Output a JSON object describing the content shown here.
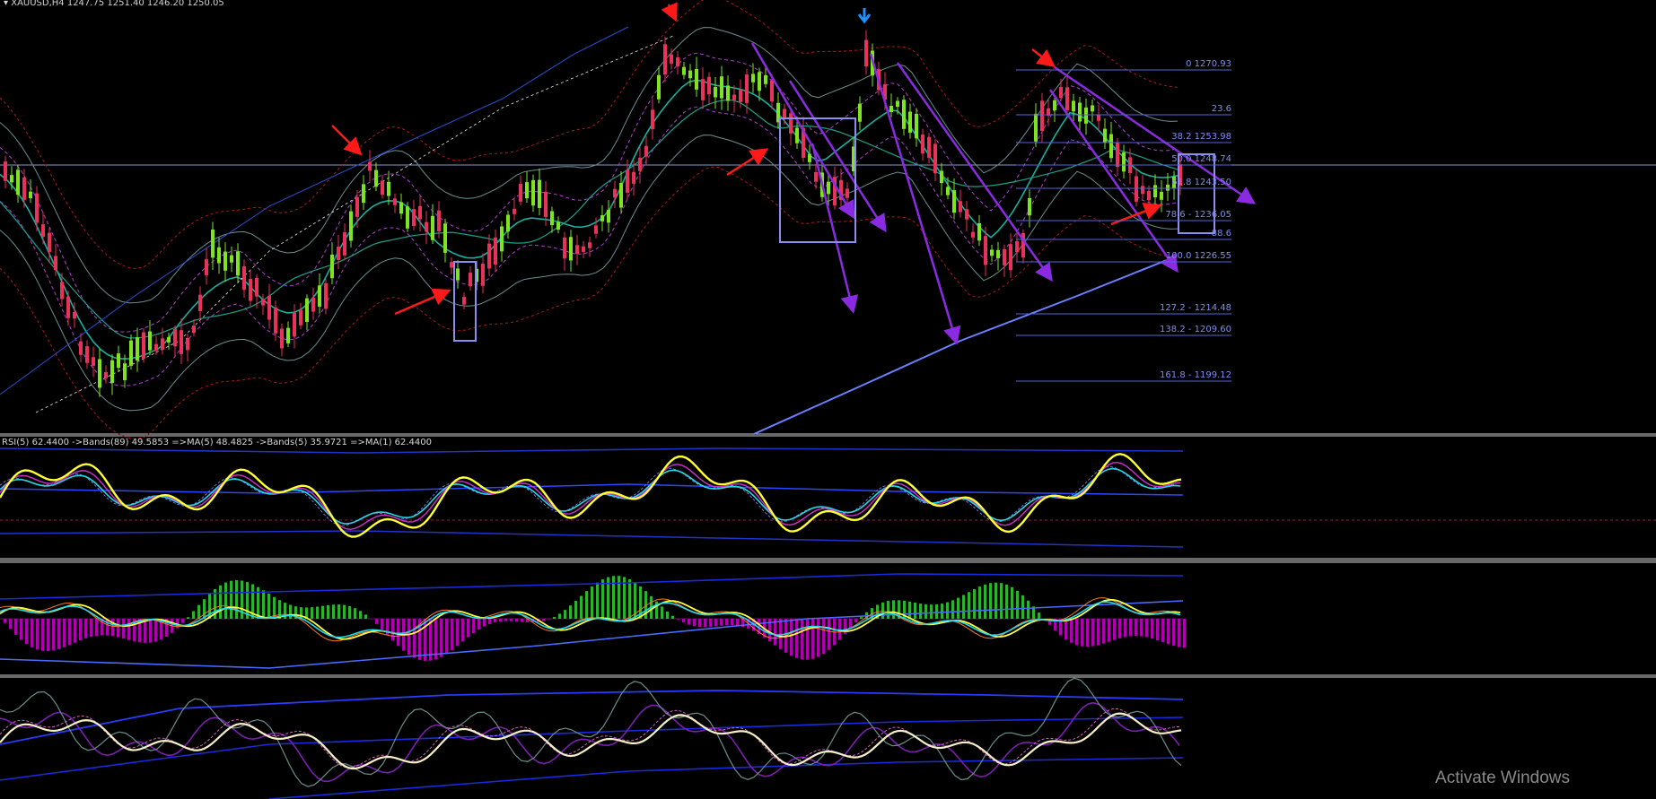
{
  "header": {
    "symbol_line": "XAUUSD,H4  1247.75 1251.40 1246.20 1250.05"
  },
  "rsi_panel": {
    "label": "RSI(5) 62.4400  ->Bands(89) 49.5853  =>MA(5) 48.4825  ->Bands(5) 35.9721  =>MA(1) 62.4400"
  },
  "fib_levels": [
    {
      "text": "0 1270.93"
    },
    {
      "text": "23.6"
    },
    {
      "text": "38.2 1253.98"
    },
    {
      "text": "50.0 1248.74"
    },
    {
      "text": "61.8 1243.50"
    },
    {
      "text": "78.6 - 1236.05"
    },
    {
      "text": "88.6"
    },
    {
      "text": "100.0 1226.55"
    },
    {
      "text": "127.2 - 1214.48"
    },
    {
      "text": "138.2 - 1209.60"
    },
    {
      "text": "161.8 - 1199.12"
    }
  ],
  "watermark": "Activate Windows",
  "colors": {
    "background": "#000000",
    "bull_candle": "#7ee41f",
    "bear_candle": "#e8325a",
    "annotation_arrow": "#8a2be2",
    "signal_arrow": "#ff1a1a",
    "marker_arrow": "#1e90ff",
    "rsi_line": "#ffff33",
    "fib_line": "#5566dd"
  }
}
